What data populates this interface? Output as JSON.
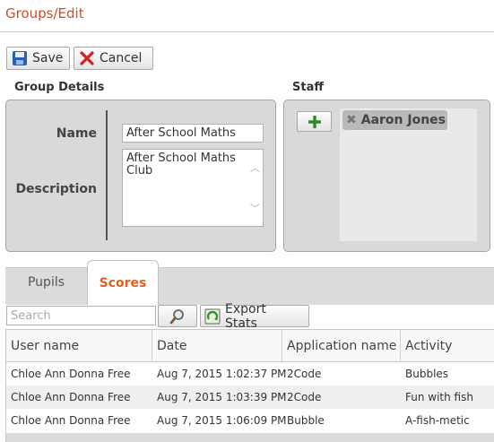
{
  "page": {
    "title": "Groups/Edit"
  },
  "toolbar": {
    "save_label": "Save",
    "cancel_label": "Cancel"
  },
  "group_details": {
    "heading": "Group Details",
    "name_label": "Name",
    "name_value": "After School Maths",
    "description_label": "Description",
    "description_value": "After School Maths Club"
  },
  "staff": {
    "heading": "Staff",
    "members": [
      "Aaron Jones"
    ]
  },
  "tabs": [
    {
      "label": "Pupils",
      "active": false
    },
    {
      "label": "Scores",
      "active": true
    }
  ],
  "scores": {
    "search_placeholder": "Search",
    "export_label": "Export Stats",
    "columns": [
      "User name",
      "Date",
      "Application name",
      "Activity"
    ],
    "rows": [
      [
        "Chloe Ann Donna Free",
        "Aug 7, 2015 1:02:37 PM",
        "2Code",
        "Bubbles"
      ],
      [
        "Chloe Ann Donna Free",
        "Aug 7, 2015 1:03:39 PM",
        "2Code",
        "Fun with fish"
      ],
      [
        "Chloe Ann Donna Free",
        "Aug 7, 2015 1:06:09 PM",
        "Bubble",
        "A-fish-metic"
      ]
    ]
  },
  "colors": {
    "title": "#c9502a",
    "active_tab": "#e0611f",
    "panel": "#d9d9d9",
    "add_icon": "#2e8b2e",
    "cancel_icon": "#d42020",
    "save_icon": "#2b5fae"
  }
}
